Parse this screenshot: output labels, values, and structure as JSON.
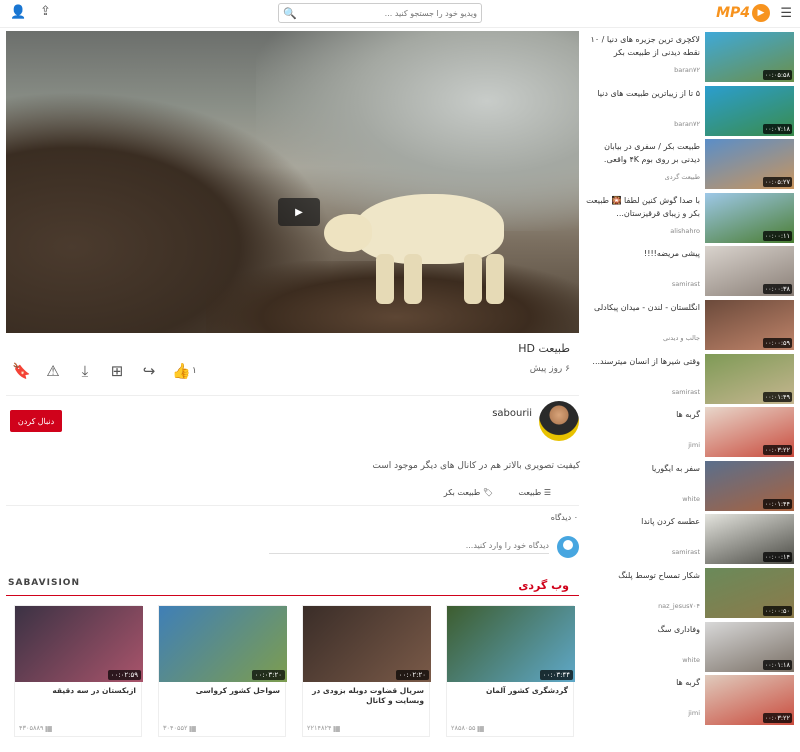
{
  "header": {
    "search_placeholder": "ویدیو خود را جستجو کنید ...",
    "logo_text": "MP4"
  },
  "video": {
    "title": "طبیعت HD",
    "date": "۶ روز پیش",
    "like_count": "۱",
    "views": "۰ دیدگاه"
  },
  "channel": {
    "name": "sabourii",
    "follow_label": "دنبال کردن",
    "description": "کیفیت تصویری بالاتر هم در کانال های دیگر موجود است",
    "tag_category": "طبیعت",
    "tag_label": "طبیعت بکر"
  },
  "comments": {
    "placeholder": "دیدگاه خود را وارد کنید..."
  },
  "ads": {
    "label": "SABAVISION",
    "section_title": "وب گردی",
    "cards": [
      {
        "title": "ازبکستان در سه دقیقه",
        "duration": "۰۰:۰۲:۵۹",
        "meta": "۴۳۰۵۸۸۹",
        "colors": [
          "#3b3244",
          "#a9546b"
        ]
      },
      {
        "title": "سواحل کشور کرواسی",
        "duration": "۰۰:۰۳:۲۰",
        "meta": "۳۰۴۰۵۵۲",
        "colors": [
          "#3f7fb7",
          "#7d9d4f"
        ]
      },
      {
        "title": "سریال قضاوت دوبله بزودی در وبسایت و کانال",
        "duration": "۰۰:۰۲:۲۰",
        "meta": "۲۲۱۴۸۲۴",
        "colors": [
          "#3a2d28",
          "#7a5a48"
        ]
      },
      {
        "title": "گردشگری کشور آلمان",
        "duration": "۰۰:۰۳:۴۴",
        "meta": "۲۸۵۸۰۵۵",
        "colors": [
          "#3d5d2f",
          "#5fa8c8"
        ]
      }
    ]
  },
  "sidebar": {
    "items": [
      {
        "title": "لاکچری ترین جزیره های دنیا / ۱۰ نقطه دیدنی از طبیعت بکر",
        "channel": "baran۷۲",
        "duration": "۰۰:۰۵:۵۸",
        "colors": [
          "#3fa9d8",
          "#6b8f4a"
        ]
      },
      {
        "title": "۵ تا از زیباترین طبیعت های دنیا",
        "channel": "baran۷۲",
        "duration": "۰۰:۰۷:۱۸",
        "colors": [
          "#2b9ecf",
          "#3a8c4c"
        ]
      },
      {
        "title": "طبیعت بکر / سفری در بیابان دیدنی بر روی بوم ۴K واقعی.",
        "channel": "طبیعت گردی",
        "duration": "۰۰:۰۵:۲۷",
        "colors": [
          "#5a8ec8",
          "#c9955d"
        ]
      },
      {
        "title": "با صدا گوش کنین لطفا 🎇 طبیعت بکر و زیبای قرقیزستان...",
        "channel": "alishahro",
        "duration": "۰۰:۰۰:۱۱",
        "colors": [
          "#9ec8e8",
          "#4a7d32"
        ]
      },
      {
        "title": "پیشی مریضه!!!!",
        "channel": "samirast",
        "duration": "۰۰:۰۰:۳۸",
        "colors": [
          "#d9d3cd",
          "#8a7f77"
        ]
      },
      {
        "title": "انگلستان - لندن - میدان پیکادلی",
        "channel": "جالب و دیدنی",
        "duration": "۰۰:۰۰:۵۹",
        "colors": [
          "#6b4a3b",
          "#c0846a"
        ]
      },
      {
        "title": "وقتی شیرها از انسان میترسند...",
        "channel": "samirast",
        "duration": "۰۰:۰۱:۴۹",
        "colors": [
          "#7e9a56",
          "#c6b690"
        ]
      },
      {
        "title": "گربه ها",
        "channel": "jimi",
        "duration": "۰۰:۰۳:۲۲",
        "colors": [
          "#e8d7cb",
          "#c94b3d"
        ]
      },
      {
        "title": "سفر به ایگوریا",
        "channel": "white",
        "duration": "۰۰:۰۱:۴۴",
        "colors": [
          "#5a6f8c",
          "#a8623f"
        ]
      },
      {
        "title": "عطسه کردن پاندا",
        "channel": "samirast",
        "duration": "۰۰:۰۰:۱۴",
        "colors": [
          "#e4e4de",
          "#4a4a44"
        ]
      },
      {
        "title": "شکار تمساح توسط پلنگ",
        "channel": "naz_jesus۷۰۴",
        "duration": "۰۰:۰۰:۵۰",
        "colors": [
          "#6a8a5a",
          "#8c7a4a"
        ]
      },
      {
        "title": "وفاداری سگ",
        "channel": "white",
        "duration": "۰۰:۰۱:۱۸",
        "colors": [
          "#d8d8d8",
          "#7a7066"
        ]
      },
      {
        "title": "گربه ها",
        "channel": "jimi",
        "duration": "۰۰:۰۳:۲۲",
        "colors": [
          "#e0cbbd",
          "#c94b3d"
        ]
      }
    ]
  }
}
